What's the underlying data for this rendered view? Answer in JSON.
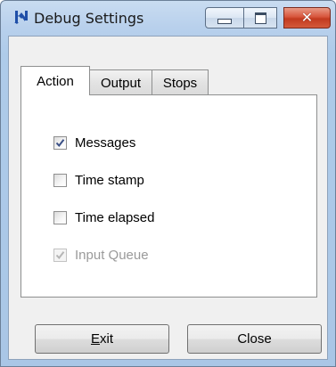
{
  "window": {
    "title": "Debug Settings",
    "icon": "debug-app-icon",
    "controls": {
      "minimize": "minimize-icon",
      "maximize": "maximize-icon",
      "close": "close-icon"
    },
    "accent_colors": {
      "close_button": "#c9452b",
      "frame": "#b9d1ea"
    }
  },
  "tabs": [
    {
      "label": "Action",
      "active": true
    },
    {
      "label": "Output",
      "active": false
    },
    {
      "label": "Stops",
      "active": false
    }
  ],
  "options": [
    {
      "label": "Messages",
      "checked": true,
      "enabled": true
    },
    {
      "label": "Time stamp",
      "checked": false,
      "enabled": true
    },
    {
      "label": "Time elapsed",
      "checked": false,
      "enabled": true
    },
    {
      "label": "Input Queue",
      "checked": true,
      "enabled": false
    }
  ],
  "buttons": {
    "exit": {
      "mnemonic": "E",
      "rest": "xit"
    },
    "close": "Close"
  }
}
